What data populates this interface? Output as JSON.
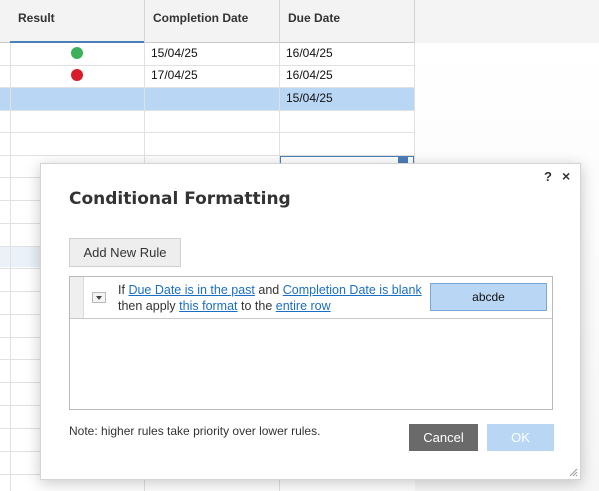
{
  "sheet": {
    "columns": [
      "Result",
      "Completion Date",
      "Due Date"
    ],
    "rows": [
      {
        "result_color": "#3cb05b",
        "completion": "15/04/25",
        "due": "16/04/25"
      },
      {
        "result_color": "#d81b2b",
        "completion": "17/04/25",
        "due": "16/04/25"
      },
      {
        "result_color": "",
        "completion": "",
        "due": "15/04/25"
      }
    ]
  },
  "dialog": {
    "title": "Conditional Formatting",
    "help_icon": "?",
    "close_icon": "×",
    "add_rule_label": "Add New Rule",
    "rule": {
      "if_word": "If",
      "condition1": "Due Date is in the past",
      "and_word": "and",
      "condition2": "Completion Date is blank",
      "then_text": "then apply",
      "format_link": "this format",
      "to_text": "to the",
      "target_link": "entire row",
      "preview_text": "abcde"
    },
    "note": "Note: higher rules take priority over lower rules.",
    "cancel_label": "Cancel",
    "ok_label": "OK"
  },
  "colors": {
    "accent": "#1a6fc4",
    "selection": "#b9d7f5",
    "cancel_bg": "#6a6a6a"
  }
}
